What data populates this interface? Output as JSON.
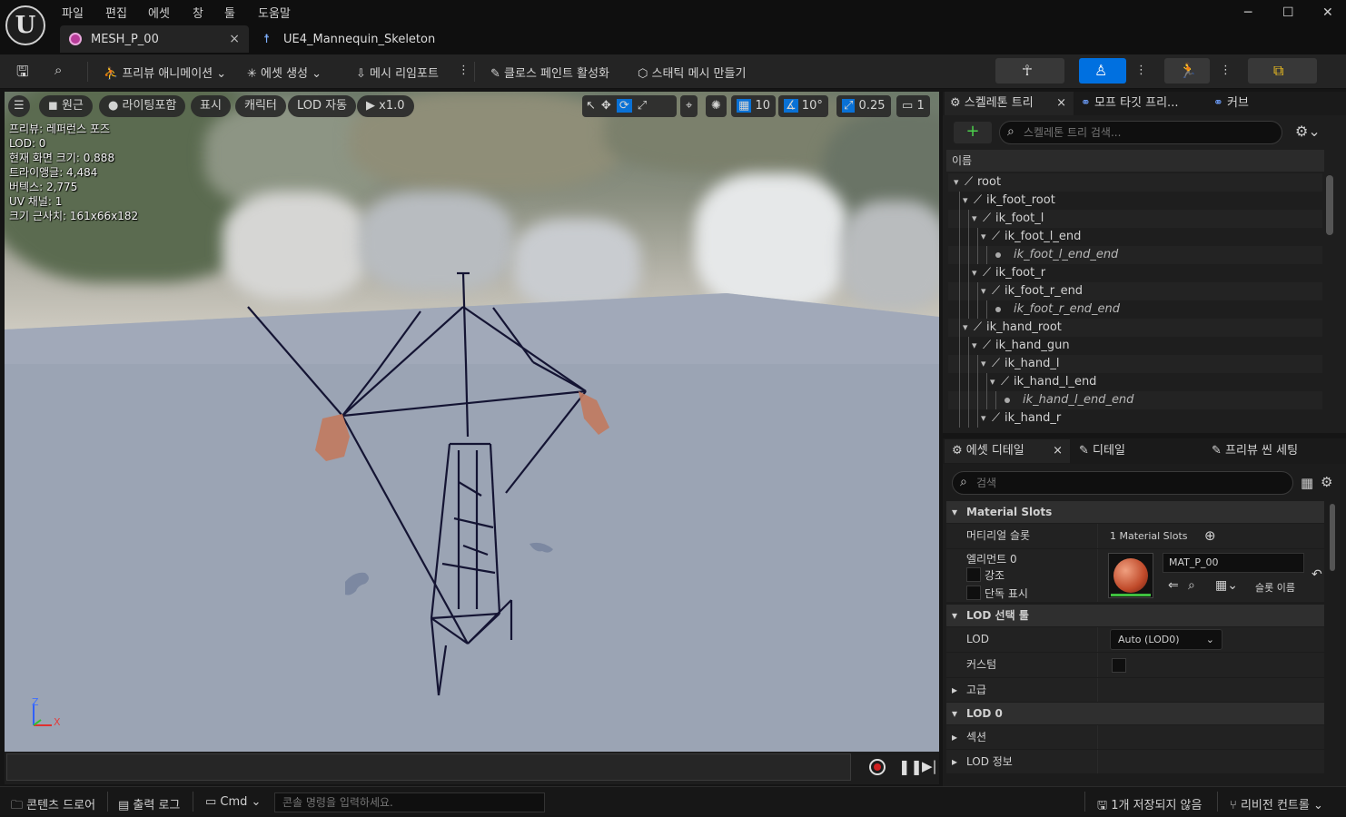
{
  "menu": [
    "파일",
    "편집",
    "에셋",
    "창",
    "툴",
    "도움말"
  ],
  "tabs": {
    "mesh": "MESH_P_00",
    "skeleton": "UE4_Mannequin_Skeleton",
    "close": "×"
  },
  "window": {
    "minimize": "─",
    "maximize": "☐",
    "close": "✕"
  },
  "toolbar": {
    "preview_anim": "프리뷰 애니메이션",
    "asset_create": "에셋 생성",
    "mesh_reimport": "메시 리임포트",
    "cloth_paint": "클로스 페인트 활성화",
    "static_mesh": "스태틱 메시 만들기"
  },
  "viewport": {
    "buttons": {
      "perspective": "원근",
      "lighting": "라이팅포함",
      "show": "표시",
      "character": "캐릭터",
      "lod": "LOD 자동",
      "speed": "x1.0",
      "grid": "10",
      "angle": "10°",
      "scale": "0.25",
      "camera": "1"
    },
    "stats": [
      "프리뷰: 레퍼런스 포즈",
      "LOD: 0",
      "현재 화면 크기: 0.888",
      "트라이앵글: 4,484",
      "버텍스: 2,775",
      "UV 채널: 1",
      "크기 근사치: 161x66x182"
    ],
    "axis": {
      "z": "Z",
      "x": "X"
    }
  },
  "skeleton_tree": {
    "tabs": {
      "tree": "스켈레톤 트리",
      "morph": "모프 타깃 프리...",
      "curve": "커브"
    },
    "add": "+",
    "search_placeholder": "스켈레톤 트리 검색...",
    "column": "이름",
    "bones": [
      {
        "name": "root",
        "depth": 0,
        "type": "bone",
        "italic": false
      },
      {
        "name": "ik_foot_root",
        "depth": 1,
        "type": "bone",
        "italic": false
      },
      {
        "name": "ik_foot_l",
        "depth": 2,
        "type": "bone",
        "italic": false
      },
      {
        "name": "ik_foot_l_end",
        "depth": 3,
        "type": "bone",
        "italic": false
      },
      {
        "name": "ik_foot_l_end_end",
        "depth": 4,
        "type": "dot",
        "italic": true
      },
      {
        "name": "ik_foot_r",
        "depth": 2,
        "type": "bone",
        "italic": false
      },
      {
        "name": "ik_foot_r_end",
        "depth": 3,
        "type": "bone",
        "italic": false
      },
      {
        "name": "ik_foot_r_end_end",
        "depth": 4,
        "type": "dot",
        "italic": true
      },
      {
        "name": "ik_hand_root",
        "depth": 1,
        "type": "bone",
        "italic": false
      },
      {
        "name": "ik_hand_gun",
        "depth": 2,
        "type": "bone",
        "italic": false
      },
      {
        "name": "ik_hand_l",
        "depth": 3,
        "type": "bone",
        "italic": false
      },
      {
        "name": "ik_hand_l_end",
        "depth": 4,
        "type": "bone",
        "italic": false
      },
      {
        "name": "ik_hand_l_end_end",
        "depth": 5,
        "type": "dot",
        "italic": true
      },
      {
        "name": "ik_hand_r",
        "depth": 3,
        "type": "bone",
        "italic": false
      }
    ]
  },
  "details": {
    "tabs": {
      "asset_details": "에셋 디테일",
      "details": "디테일",
      "preview_scene": "프리뷰 씬 세팅"
    },
    "search_placeholder": "검색",
    "material_slots": {
      "header": "Material Slots",
      "label": "머티리얼 슬롯",
      "value": "1 Material Slots",
      "element": "엘리먼트 0",
      "highlight": "강조",
      "isolate": "단독 표시",
      "material": "MAT_P_00",
      "slot_name": "슬롯 이름"
    },
    "lod_picker": {
      "header": "LOD 선택 툴",
      "lod_label": "LOD",
      "lod_value": "Auto (LOD0)",
      "custom_label": "커스텀"
    },
    "advanced": "고급",
    "lod0": {
      "header": "LOD 0",
      "sections": "섹션",
      "info": "LOD 정보"
    }
  },
  "statusbar": {
    "content_drawer": "콘텐츠 드로어",
    "output_log": "출력 로그",
    "cmd": "Cmd",
    "console_placeholder": "콘솔 명령을 입력하세요.",
    "unsaved": "1개 저장되지 않음",
    "revision": "리비전 컨트롤"
  },
  "colors": {
    "accent_blue": "#0070e0",
    "skeleton": "#1a1a3a",
    "floor": "#9aa3b3"
  }
}
